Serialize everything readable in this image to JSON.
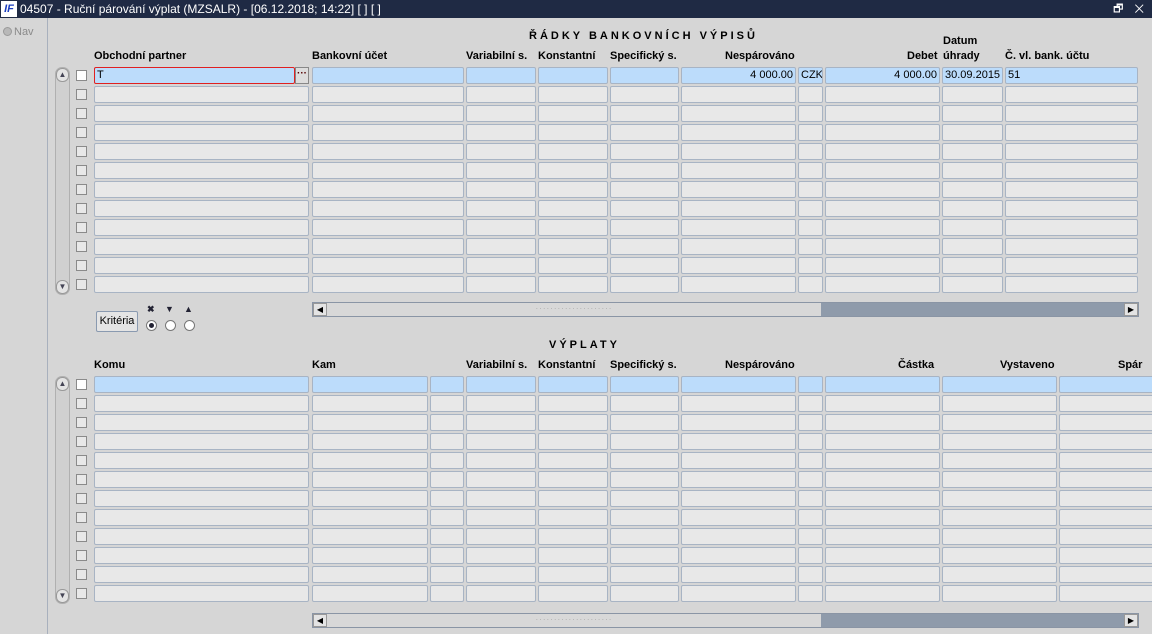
{
  "window": {
    "title": "04507 - Ruční párování výplat (MZSALR) - [06.12.2018; 14:22]  [ ]  [ ]",
    "logo": "IF",
    "controls": "🗗 ✕"
  },
  "nav": {
    "label": "Nav"
  },
  "bank": {
    "section_title": "ŘÁDKY BANKOVNÍCH VÝPISŮ",
    "headers": {
      "partner": "Obchodní partner",
      "account": "Bankovní účet",
      "var": "Variabilní s.",
      "konst": "Konstantní",
      "spec": "Specifický s.",
      "nespar": "Nespárováno",
      "debet": "Debet",
      "datum1": "Datum",
      "datum2": "úhrady",
      "cislo": "Č. vl. bank. účtu"
    },
    "rows": [
      {
        "partner": "T",
        "account": "",
        "var": "",
        "konst": "",
        "spec": "",
        "nespar": "4 000.00",
        "cur": "CZK",
        "debet": "4 000.00",
        "datum": "30.09.2015",
        "cislo": "51"
      },
      {},
      {},
      {},
      {},
      {},
      {},
      {},
      {},
      {},
      {},
      {}
    ]
  },
  "criteria": {
    "button": "Kritéria",
    "options": [
      "clear",
      "descending",
      "ascending"
    ],
    "selected": 0
  },
  "payouts": {
    "section_title": "VÝPLATY",
    "headers": {
      "komu": "Komu",
      "kam": "Kam",
      "var": "Variabilní s.",
      "konst": "Konstantní",
      "spec": "Specifický s.",
      "nespar": "Nespárováno",
      "castka": "Částka",
      "vystaveno": "Vystaveno",
      "spar": "Spár"
    },
    "rows": [
      {},
      {},
      {},
      {},
      {},
      {},
      {},
      {},
      {},
      {},
      {},
      {}
    ]
  }
}
